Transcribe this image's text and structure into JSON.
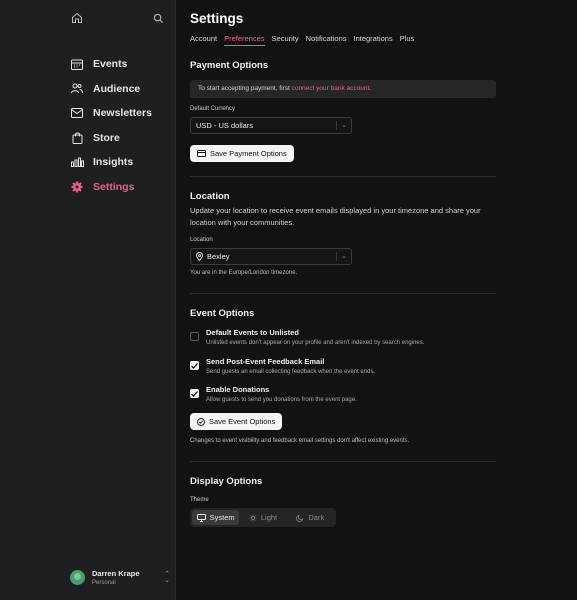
{
  "sidebar": {
    "home_icon": "home-icon",
    "search_icon": "search-icon",
    "items": [
      {
        "label": "Events",
        "icon": "calendar-icon",
        "active": false
      },
      {
        "label": "Audience",
        "icon": "users-icon",
        "active": false
      },
      {
        "label": "Newsletters",
        "icon": "mail-icon",
        "active": false
      },
      {
        "label": "Store",
        "icon": "bag-icon",
        "active": false
      },
      {
        "label": "Insights",
        "icon": "bar-chart-icon",
        "active": false
      },
      {
        "label": "Settings",
        "icon": "gear-icon",
        "active": true
      }
    ],
    "user": {
      "name": "Darren Krape",
      "subtitle": "Personal"
    }
  },
  "header": {
    "title": "Settings",
    "tabs": [
      {
        "label": "Account",
        "active": false
      },
      {
        "label": "Preferences",
        "active": true
      },
      {
        "label": "Security",
        "active": false
      },
      {
        "label": "Notifications",
        "active": false
      },
      {
        "label": "Integrations",
        "active": false
      },
      {
        "label": "Plus",
        "active": false
      }
    ]
  },
  "payment": {
    "title": "Payment Options",
    "notice_prefix": "To start accepting payment, first ",
    "notice_link": "connect your bank account",
    "notice_suffix": ".",
    "currency_label": "Default Currency",
    "currency_value": "USD - US dollars",
    "save_label": "Save Payment Options"
  },
  "location": {
    "title": "Location",
    "description": "Update your location to receive event emails displayed in your timezone and share your location with your communities.",
    "field_label": "Location",
    "value": "Bexley",
    "timezone_note": "You are in the Europe/London timezone."
  },
  "events": {
    "title": "Event Options",
    "options": [
      {
        "title": "Default Events to Unlisted",
        "subtitle": "Unlisted events don't appear on your profile and aren't indexed by search engines.",
        "checked": false
      },
      {
        "title": "Send Post-Event Feedback Email",
        "subtitle": "Send guests an email collecting feedback when the event ends.",
        "checked": true
      },
      {
        "title": "Enable Donations",
        "subtitle": "Allow guests to send you donations from the event page.",
        "checked": true
      }
    ],
    "save_label": "Save Event Options",
    "footnote": "Changes to event visibility and feedback email settings don't affect existing events."
  },
  "display": {
    "title": "Display Options",
    "theme_label": "Theme",
    "themes": [
      {
        "label": "System",
        "active": true
      },
      {
        "label": "Light",
        "active": false
      },
      {
        "label": "Dark",
        "active": false
      }
    ]
  },
  "colors": {
    "accent": "#e8618c",
    "background": "#121212",
    "sidebar": "#1f1f21"
  }
}
